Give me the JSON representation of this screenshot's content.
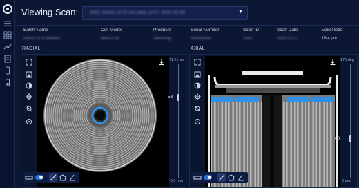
{
  "app": {
    "accent": "#2f8fe6"
  },
  "sidebar": {
    "icons": [
      "logo-icon",
      "menu-icon",
      "grid-icon",
      "trend-icon",
      "notes-icon",
      "phone-icon",
      "battery-icon"
    ]
  },
  "header": {
    "viewing_label": "Viewing Scan:",
    "scan_value": "0001 Demo 2170 cell data 12/17 2020 02:54"
  },
  "meta": {
    "headers": [
      "Batch Name",
      "Cell Model",
      "Producer",
      "Serial Number",
      "Scan ID",
      "Scan Date",
      "Voxel Size"
    ],
    "values": [
      "Demo 2170 product",
      "INR21700",
      "Samsung",
      "000000000",
      "1002",
      "2020-12-17",
      "16.4 μm"
    ]
  },
  "radial": {
    "title": "RADIAL",
    "scale_top": "71.2 mm",
    "scale_value": "53",
    "scale_bottom": "-0.3 mm",
    "slider_fraction": 0.29
  },
  "axial": {
    "title": "AXIAL",
    "scale_top": "175 deg",
    "scale_value": "60",
    "scale_bottom": "0 deg",
    "slider_fraction": 0.66
  }
}
